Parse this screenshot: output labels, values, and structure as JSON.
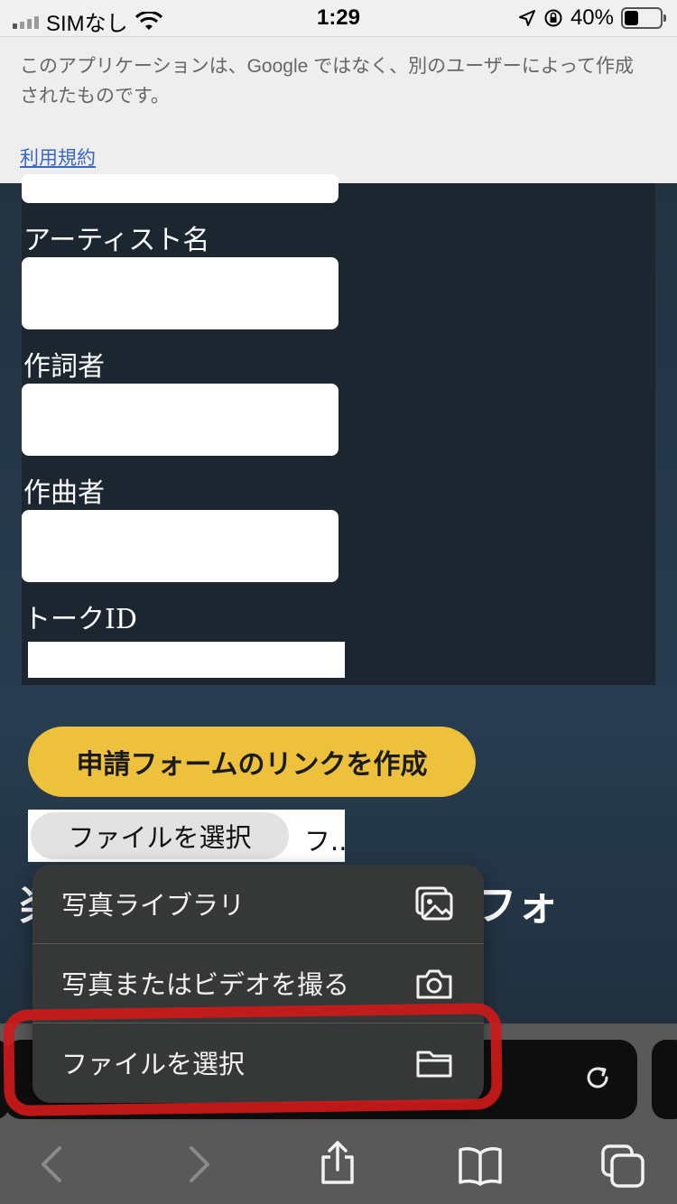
{
  "status_bar": {
    "carrier": "SIMなし",
    "time": "1:29",
    "battery_percent": "40%",
    "battery_level": 0.4
  },
  "notice": {
    "text": "このアプリケーションは、Google ではなく、別のユーザーによって作成されたものです。",
    "link": "利用規約"
  },
  "form": {
    "fields": [
      {
        "label": "アーティスト名"
      },
      {
        "label": "作詞者"
      },
      {
        "label": "作曲者"
      },
      {
        "label": "トークID"
      }
    ],
    "create_button": "申請フォームのリンクを作成",
    "file_button": "ファイルを選択",
    "file_status": "フ..",
    "behind_title": "楽曲申請フォームの申請フォ"
  },
  "menu": {
    "items": [
      {
        "label": "写真ライブラリ",
        "icon": "photo-library-icon"
      },
      {
        "label": "写真またはビデオを撮る",
        "icon": "camera-icon"
      },
      {
        "label": "ファイルを選択",
        "icon": "folder-icon"
      }
    ]
  },
  "colors": {
    "accent_button": "#edc13b",
    "panel": "#1b2631",
    "highlight": "#d01a1a"
  }
}
